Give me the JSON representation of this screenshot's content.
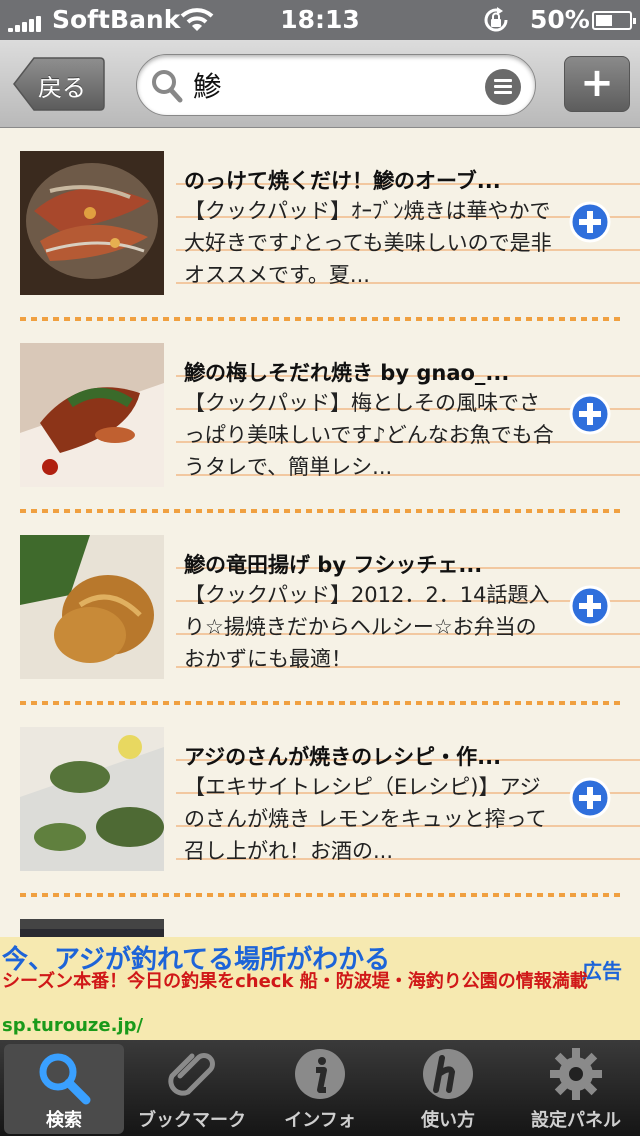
{
  "status_bar": {
    "carrier": "SoftBank",
    "time": "18:13",
    "battery": "50%"
  },
  "navbar": {
    "back_label": "戻る",
    "search_value": "鯵",
    "add_label": "+"
  },
  "results": [
    {
      "title": "のっけて焼くだけ！鯵のオーブ...",
      "desc": "【クックパッド】ｵｰﾌﾞﾝ焼きは華やかで大好きです♪とっても美味しいので是非オススメです。夏..."
    },
    {
      "title": "鯵の梅しそだれ焼き by gnao_...",
      "desc": "【クックパッド】梅としその風味でさっぱり美味しいです♪どんなお魚でも合うタレで、簡単レシ..."
    },
    {
      "title": "鯵の竜田揚げ by フシッチェ...",
      "desc": "【クックパッド】2012．2．14話題入り☆揚焼きだからヘルシー☆お弁当のおかずにも最適！"
    },
    {
      "title": "アジのさんが焼きのレシピ・作...",
      "desc": "【エキサイトレシピ（Eレシピ)】アジのさんが焼き レモンをキュッと搾って召し上がれ！お酒の..."
    }
  ],
  "ad": {
    "headline": "今、アジが釣れてる場所がわかる",
    "tag": "広告",
    "body": "シーズン本番！今日の釣果をcheck 船・防波堤・海釣り公園の情報満載",
    "url": "sp.turouze.jp/"
  },
  "tabs": [
    {
      "label": "検索",
      "icon": "search-icon",
      "active": true
    },
    {
      "label": "ブックマーク",
      "icon": "paperclip-icon",
      "active": false
    },
    {
      "label": "インフォ",
      "icon": "info-icon",
      "active": false
    },
    {
      "label": "使い方",
      "icon": "help-h-icon",
      "active": false
    },
    {
      "label": "設定パネル",
      "icon": "gear-icon",
      "active": false
    }
  ],
  "colors": {
    "accent_blue": "#1d64d8",
    "ad_red": "#d01818",
    "ad_green": "#1a9a1a",
    "list_bg": "#f6f2e6"
  }
}
